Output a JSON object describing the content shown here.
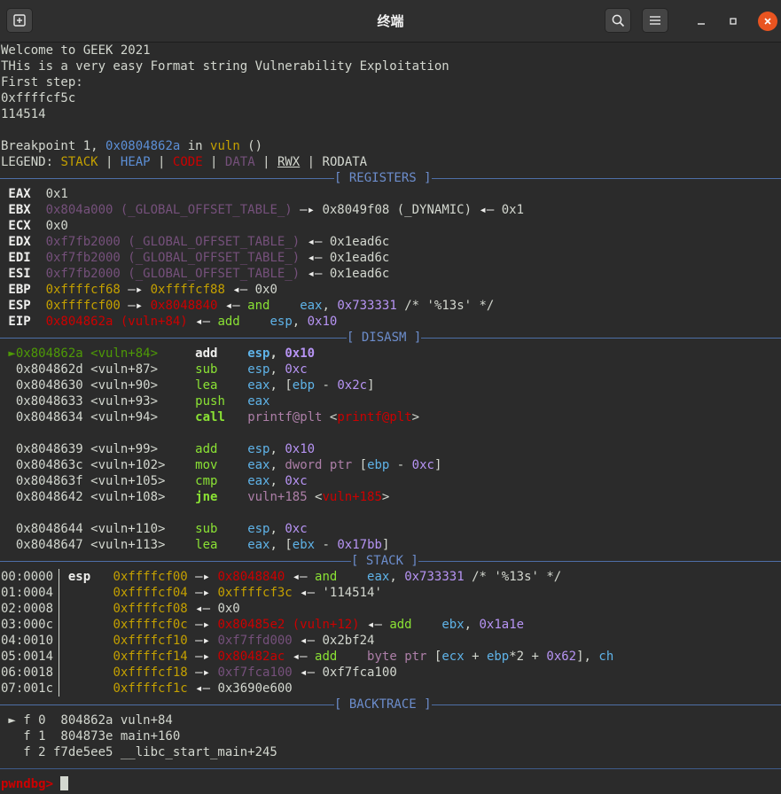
{
  "window": {
    "title": "终端",
    "new_tab_icon": "new-tab-icon",
    "search_icon": "search-icon",
    "menu_icon": "hamburger-menu-icon",
    "minimize_icon": "minimize-icon",
    "maximize_icon": "maximize-icon",
    "close_icon": "close-icon",
    "close_color": "#e95420"
  },
  "intro": {
    "line1": "Welcome to GEEK 2021",
    "line2": "THis is a very easy Format string Vulnerability Exploitation",
    "line3": "First step:",
    "line4": "0xffffcf5c",
    "line5": "114514"
  },
  "breakpoint": {
    "prefix": "Breakpoint 1, ",
    "addr": "0x0804862a",
    "in": " in ",
    "func": "vuln",
    "suffix": " ()"
  },
  "legend": {
    "label": "LEGEND: ",
    "stack": "STACK",
    "heap": "HEAP",
    "code": "CODE",
    "data": "DATA",
    "rwx": "RWX",
    "rodata": "RODATA",
    "sep": " | "
  },
  "sections": {
    "registers": "[ REGISTERS ]",
    "disasm": "[ DISASM ]",
    "stack": "[ STACK ]",
    "backtrace": "[ BACKTRACE ]"
  },
  "registers": [
    {
      "name": " EAX",
      "parts": [
        [
          "gray",
          "0x1"
        ]
      ]
    },
    {
      "name": " EBX",
      "parts": [
        [
          "mag",
          "0x804a000 (_GLOBAL_OFFSET_TABLE_)"
        ],
        [
          "wht",
          " —▸ "
        ],
        [
          "gray",
          "0x8049f08 (_DYNAMIC)"
        ],
        [
          "wht",
          " ◂— "
        ],
        [
          "gray",
          "0x1"
        ]
      ]
    },
    {
      "name": " ECX",
      "parts": [
        [
          "gray",
          "0x0"
        ]
      ]
    },
    {
      "name": " EDX",
      "parts": [
        [
          "mag",
          "0xf7fb2000 (_GLOBAL_OFFSET_TABLE_)"
        ],
        [
          "wht",
          " ◂— "
        ],
        [
          "gray",
          "0x1ead6c"
        ]
      ]
    },
    {
      "name": " EDI",
      "parts": [
        [
          "mag",
          "0xf7fb2000 (_GLOBAL_OFFSET_TABLE_)"
        ],
        [
          "wht",
          " ◂— "
        ],
        [
          "gray",
          "0x1ead6c"
        ]
      ]
    },
    {
      "name": " ESI",
      "parts": [
        [
          "mag",
          "0xf7fb2000 (_GLOBAL_OFFSET_TABLE_)"
        ],
        [
          "wht",
          " ◂— "
        ],
        [
          "gray",
          "0x1ead6c"
        ]
      ]
    },
    {
      "name": " EBP",
      "parts": [
        [
          "yel",
          "0xffffcf68"
        ],
        [
          "wht",
          " —▸ "
        ],
        [
          "yel",
          "0xffffcf88"
        ],
        [
          "wht",
          " ◂— "
        ],
        [
          "gray",
          "0x0"
        ]
      ]
    },
    {
      "name": " ESP",
      "parts": [
        [
          "yel",
          "0xffffcf00"
        ],
        [
          "wht",
          " —▸ "
        ],
        [
          "red",
          "0x8048840"
        ],
        [
          "wht",
          " ◂— "
        ],
        [
          "grn",
          "and"
        ],
        [
          "gray",
          "    "
        ],
        [
          "cyn",
          "eax"
        ],
        [
          "gray",
          ", "
        ],
        [
          "num",
          "0x733331"
        ],
        [
          "gray",
          " /* '%13s' */"
        ]
      ]
    },
    {
      "name": " EIP",
      "parts": [
        [
          "red",
          "0x804862a (vuln+84)"
        ],
        [
          "wht",
          " ◂— "
        ],
        [
          "grn",
          "add"
        ],
        [
          "gray",
          "    "
        ],
        [
          "cyn",
          "esp"
        ],
        [
          "gray",
          ", "
        ],
        [
          "num",
          "0x10"
        ]
      ]
    }
  ],
  "disasm": [
    {
      "cur": true,
      "marker": " ►",
      "addr": "0x804862a",
      "sym": "<vuln+84>",
      "mn": "add",
      "ops": [
        [
          "cyn",
          "esp"
        ],
        [
          "gray",
          ", "
        ],
        [
          "num",
          "0x10"
        ]
      ]
    },
    {
      "cur": false,
      "marker": "  ",
      "addr": "0x804862d",
      "sym": "<vuln+87>",
      "mn": "sub",
      "ops": [
        [
          "cyn",
          "esp"
        ],
        [
          "gray",
          ", "
        ],
        [
          "num",
          "0xc"
        ]
      ]
    },
    {
      "cur": false,
      "marker": "  ",
      "addr": "0x8048630",
      "sym": "<vuln+90>",
      "mn": "lea",
      "ops": [
        [
          "cyn",
          "eax"
        ],
        [
          "gray",
          ", ["
        ],
        [
          "cyn",
          "ebp"
        ],
        [
          "gray",
          " - "
        ],
        [
          "num",
          "0x2c"
        ],
        [
          "gray",
          "]"
        ]
      ]
    },
    {
      "cur": false,
      "marker": "  ",
      "addr": "0x8048633",
      "sym": "<vuln+93>",
      "mn": "push",
      "ops": [
        [
          "cyn",
          "eax"
        ]
      ]
    },
    {
      "cur": false,
      "marker": "  ",
      "addr": "0x8048634",
      "sym": "<vuln+94>",
      "mn": "call",
      "bold": true,
      "ops": [
        [
          "pur",
          "printf@plt"
        ],
        [
          "gray",
          " <"
        ],
        [
          "red",
          "printf@plt"
        ],
        [
          "gray",
          ">"
        ]
      ]
    },
    {
      "blank": true
    },
    {
      "cur": false,
      "marker": "  ",
      "addr": "0x8048639",
      "sym": "<vuln+99>",
      "mn": "add",
      "ops": [
        [
          "cyn",
          "esp"
        ],
        [
          "gray",
          ", "
        ],
        [
          "num",
          "0x10"
        ]
      ]
    },
    {
      "cur": false,
      "marker": "  ",
      "addr": "0x804863c",
      "sym": "<vuln+102>",
      "mn": "mov",
      "ops": [
        [
          "cyn",
          "eax"
        ],
        [
          "gray",
          ", "
        ],
        [
          "pur",
          "dword ptr"
        ],
        [
          "gray",
          " ["
        ],
        [
          "cyn",
          "ebp"
        ],
        [
          "gray",
          " - "
        ],
        [
          "num",
          "0xc"
        ],
        [
          "gray",
          "]"
        ]
      ]
    },
    {
      "cur": false,
      "marker": "  ",
      "addr": "0x804863f",
      "sym": "<vuln+105>",
      "mn": "cmp",
      "ops": [
        [
          "cyn",
          "eax"
        ],
        [
          "gray",
          ", "
        ],
        [
          "num",
          "0xc"
        ]
      ]
    },
    {
      "cur": false,
      "marker": "  ",
      "addr": "0x8048642",
      "sym": "<vuln+108>",
      "mn": "jne",
      "bold": true,
      "ops": [
        [
          "pur",
          "vuln+185"
        ],
        [
          "gray",
          " <"
        ],
        [
          "red",
          "vuln+185"
        ],
        [
          "gray",
          ">"
        ]
      ]
    },
    {
      "blank": true
    },
    {
      "cur": false,
      "marker": "  ",
      "addr": "0x8048644",
      "sym": "<vuln+110>",
      "mn": "sub",
      "ops": [
        [
          "cyn",
          "esp"
        ],
        [
          "gray",
          ", "
        ],
        [
          "num",
          "0xc"
        ]
      ]
    },
    {
      "cur": false,
      "marker": "  ",
      "addr": "0x8048647",
      "sym": "<vuln+113>",
      "mn": "lea",
      "ops": [
        [
          "cyn",
          "eax"
        ],
        [
          "gray",
          ", ["
        ],
        [
          "cyn",
          "ebx"
        ],
        [
          "gray",
          " - "
        ],
        [
          "num",
          "0x17bb"
        ],
        [
          "gray",
          "]"
        ]
      ]
    }
  ],
  "stack": [
    {
      "off": "00:0000",
      "reg": "esp",
      "addr": "0xffffcf00",
      "parts": [
        [
          "wht",
          " —▸ "
        ],
        [
          "red",
          "0x8048840"
        ],
        [
          "wht",
          " ◂— "
        ],
        [
          "grn",
          "and"
        ],
        [
          "gray",
          "    "
        ],
        [
          "cyn",
          "eax"
        ],
        [
          "gray",
          ", "
        ],
        [
          "num",
          "0x733331"
        ],
        [
          "gray",
          " /* '%13s' */"
        ]
      ]
    },
    {
      "off": "01:0004",
      "reg": "",
      "addr": "0xffffcf04",
      "parts": [
        [
          "wht",
          " —▸ "
        ],
        [
          "yel",
          "0xffffcf3c"
        ],
        [
          "wht",
          " ◂— "
        ],
        [
          "gray",
          "'114514'"
        ]
      ]
    },
    {
      "off": "02:0008",
      "reg": "",
      "addr": "0xffffcf08",
      "parts": [
        [
          "wht",
          " ◂— "
        ],
        [
          "gray",
          "0x0"
        ]
      ]
    },
    {
      "off": "03:000c",
      "reg": "",
      "addr": "0xffffcf0c",
      "parts": [
        [
          "wht",
          " —▸ "
        ],
        [
          "red",
          "0x80485e2 (vuln+12)"
        ],
        [
          "wht",
          " ◂— "
        ],
        [
          "grn",
          "add"
        ],
        [
          "gray",
          "    "
        ],
        [
          "cyn",
          "ebx"
        ],
        [
          "gray",
          ", "
        ],
        [
          "num",
          "0x1a1e"
        ]
      ]
    },
    {
      "off": "04:0010",
      "reg": "",
      "addr": "0xffffcf10",
      "parts": [
        [
          "wht",
          " —▸ "
        ],
        [
          "mag",
          "0xf7ffd000"
        ],
        [
          "wht",
          " ◂— "
        ],
        [
          "gray",
          "0x2bf24"
        ]
      ]
    },
    {
      "off": "05:0014",
      "reg": "",
      "addr": "0xffffcf14",
      "parts": [
        [
          "wht",
          " —▸ "
        ],
        [
          "red",
          "0x80482ac"
        ],
        [
          "wht",
          " ◂— "
        ],
        [
          "grn",
          "add"
        ],
        [
          "gray",
          "    "
        ],
        [
          "pur",
          "byte ptr"
        ],
        [
          "gray",
          " ["
        ],
        [
          "cyn",
          "ecx"
        ],
        [
          "gray",
          " + "
        ],
        [
          "cyn",
          "ebp"
        ],
        [
          "gray",
          "*2 + "
        ],
        [
          "num",
          "0x62"
        ],
        [
          "gray",
          "], "
        ],
        [
          "cyn",
          "ch"
        ]
      ]
    },
    {
      "off": "06:0018",
      "reg": "",
      "addr": "0xffffcf18",
      "parts": [
        [
          "wht",
          " —▸ "
        ],
        [
          "mag",
          "0xf7fca100"
        ],
        [
          "wht",
          " ◂— "
        ],
        [
          "gray",
          "0xf7fca100"
        ]
      ]
    },
    {
      "off": "07:001c",
      "reg": "",
      "addr": "0xffffcf1c",
      "parts": [
        [
          "wht",
          " ◂— "
        ],
        [
          "gray",
          "0x3690e600"
        ]
      ]
    }
  ],
  "backtrace": [
    {
      "text": " ► f 0  804862a vuln+84"
    },
    {
      "text": "   f 1  804873e main+160"
    },
    {
      "text": "   f 2 f7de5ee5 __libc_start_main+245"
    }
  ],
  "prompt": "pwndbg> "
}
